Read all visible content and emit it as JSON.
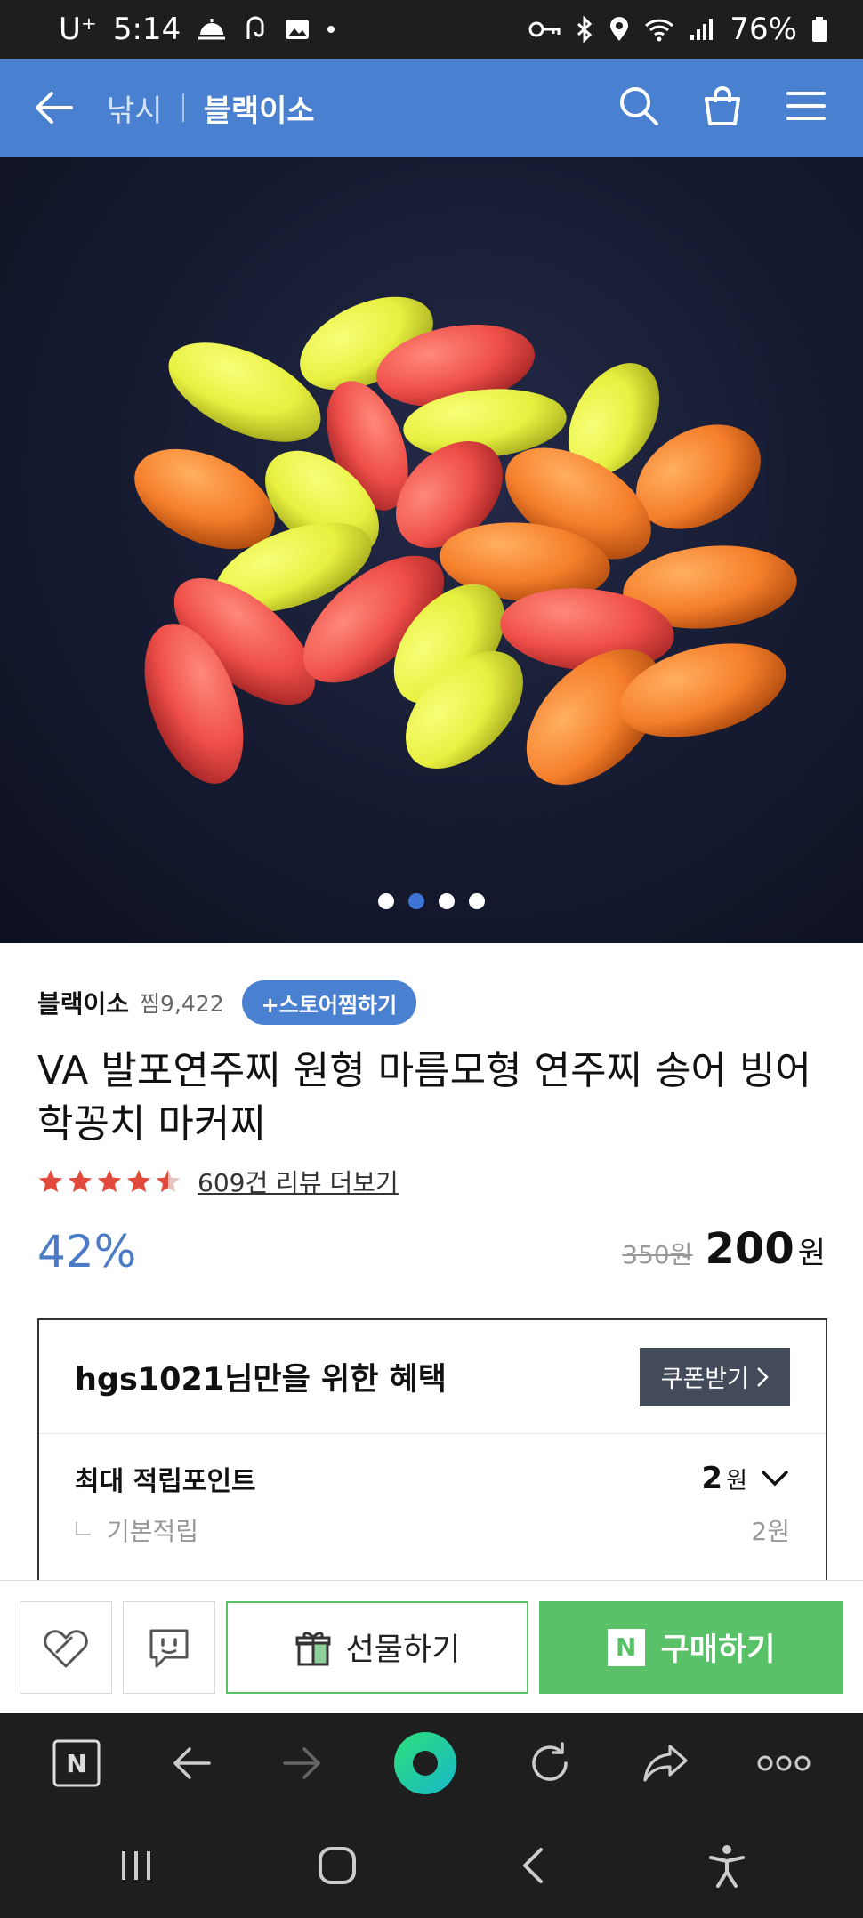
{
  "status_bar": {
    "carrier": "U⁺",
    "time": "5:14",
    "battery": "76%"
  },
  "header": {
    "breadcrumb_category": "낚시",
    "breadcrumb_store": "블랙이소"
  },
  "gallery": {
    "total_images": 4,
    "current_index": 1
  },
  "store": {
    "name": "블랙이소",
    "favorites": "찜9,422",
    "favorite_button": "+스토어찜하기"
  },
  "product": {
    "title": "VA 발포연주찌 원형 마름모형 연주찌 송어 빙어 학꽁치 마커찌",
    "rating_stars": 4.5,
    "review_link": "609건 리뷰 더보기",
    "discount": "42%",
    "original_price": "350원",
    "price": "200",
    "price_unit": "원"
  },
  "benefit": {
    "title": "hgs1021님만을 위한 혜택",
    "coupon_button": "쿠폰받기",
    "point_label": "최대 적립포인트",
    "point_value": "2",
    "point_unit": "원",
    "sub_label": "기본적립",
    "sub_value": "2원"
  },
  "actions": {
    "gift_label": "선물하기",
    "buy_label": "구매하기",
    "buy_logo": "N"
  },
  "browser": {
    "home_logo": "N"
  },
  "colors": {
    "header": "#4a80d0",
    "buy": "#59c268",
    "discount": "#4a7bc4",
    "star": "#e24a3b"
  }
}
